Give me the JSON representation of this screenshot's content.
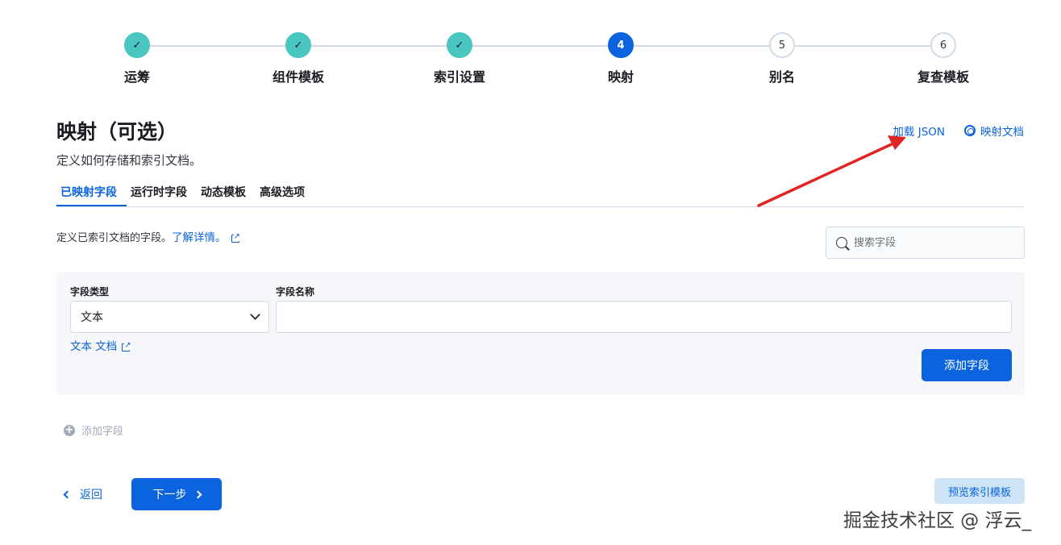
{
  "stepper": {
    "steps": [
      {
        "label": "运筹",
        "status": "done",
        "number": "✓"
      },
      {
        "label": "组件模板",
        "status": "done",
        "number": "✓"
      },
      {
        "label": "索引设置",
        "status": "done",
        "number": "✓"
      },
      {
        "label": "映射",
        "status": "current",
        "number": "4"
      },
      {
        "label": "别名",
        "status": "todo",
        "number": "5"
      },
      {
        "label": "复查模板",
        "status": "todo",
        "number": "6"
      }
    ]
  },
  "header": {
    "title": "映射（可选）",
    "description": "定义如何存储和索引文档。",
    "load_json": "加载 JSON",
    "mapping_docs": "映射文档"
  },
  "tabs": [
    {
      "label": "已映射字段",
      "active": true
    },
    {
      "label": "运行时字段",
      "active": false
    },
    {
      "label": "动态模板",
      "active": false
    },
    {
      "label": "高级选项",
      "active": false
    }
  ],
  "intro": {
    "text": "定义已索引文档的字段。",
    "learn_more": "了解详情。"
  },
  "search": {
    "placeholder": "搜索字段"
  },
  "create_field": {
    "type_label": "字段类型",
    "type_value": "文本",
    "name_label": "字段名称",
    "name_value": "",
    "doc_link": "文本 文档",
    "add_button": "添加字段"
  },
  "add_field_link": "添加字段",
  "footer": {
    "back": "返回",
    "next": "下一步",
    "preview": "预览索引模板"
  },
  "watermark": "掘金技术社区 @ 浮云_",
  "colors": {
    "primary": "#0b64dd",
    "done": "#4ac6c0",
    "annotation_arrow": "#e02424"
  }
}
